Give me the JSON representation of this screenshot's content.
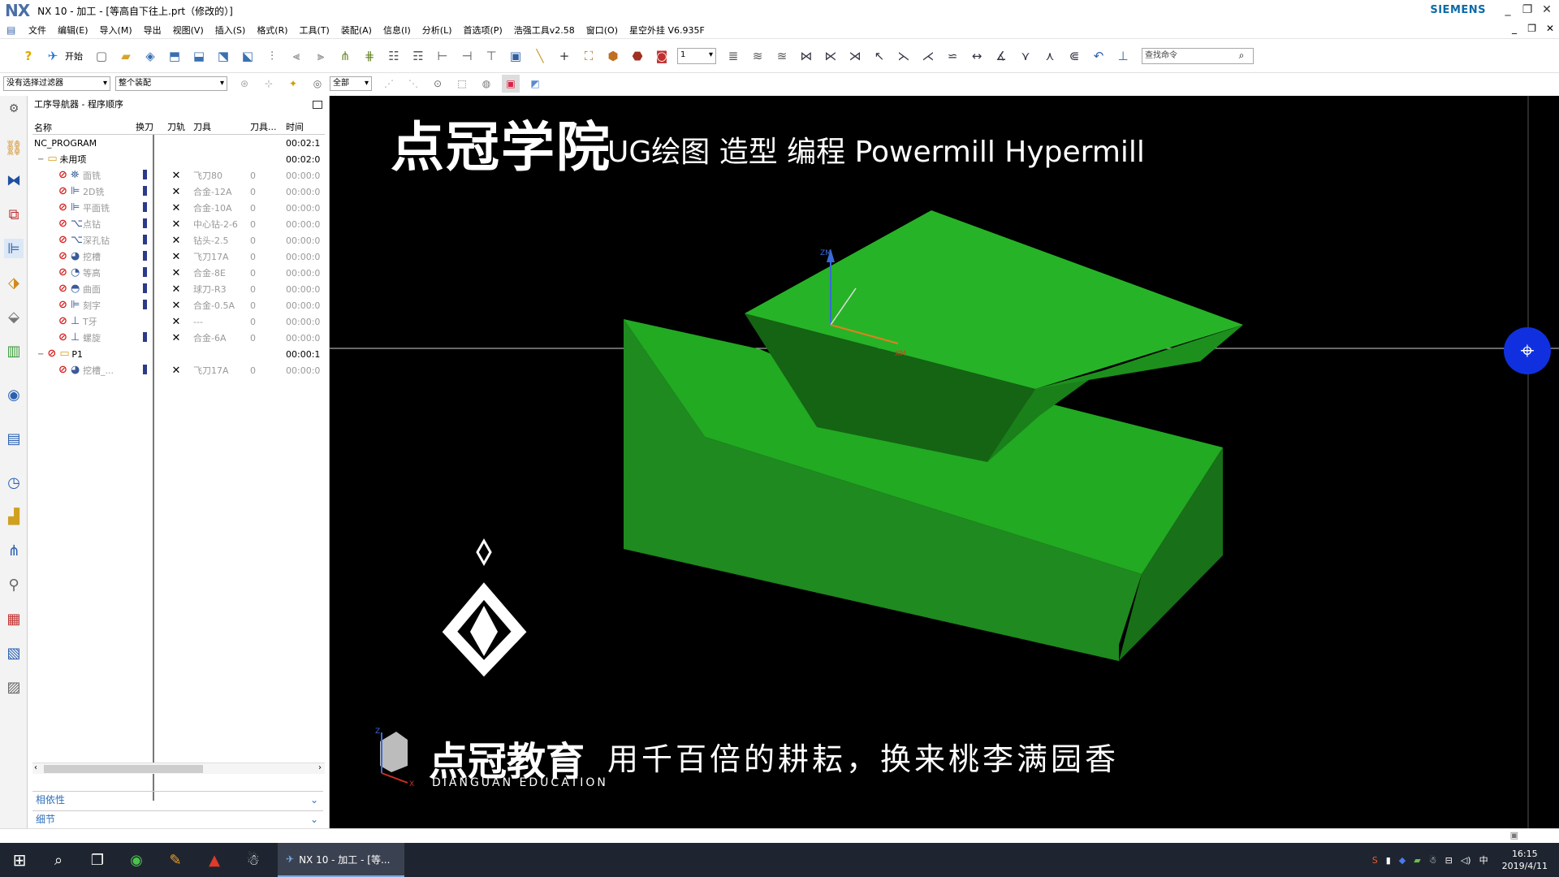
{
  "window": {
    "logo": "NX",
    "title": "NX 10 - 加工 - [等高自下往上.prt（修改的）]",
    "brand": "SIEMENS"
  },
  "menu": [
    "文件",
    "编辑(E)",
    "导入(M)",
    "导出",
    "视图(V)",
    "插入(S)",
    "格式(R)",
    "工具(T)",
    "装配(A)",
    "信息(I)",
    "分析(L)",
    "首选项(P)",
    "浩强工具v2.58",
    "窗口(O)",
    "星空外挂 V6.935F"
  ],
  "toolbar": {
    "start_label": "开始",
    "layer_value": "1",
    "search_placeholder": "查找命令"
  },
  "selection_bar": {
    "filter": "没有选择过滤器",
    "scope": "整个装配",
    "type": "全部"
  },
  "navigator": {
    "title": "工序导航器 - 程序顺序",
    "columns": [
      "名称",
      "换刀",
      "刀轨",
      "刀具",
      "刀具...",
      "时间"
    ],
    "rows": [
      {
        "name": "NC_PROGRAM",
        "time": "00:02:1",
        "level": 0
      },
      {
        "name": "未用项",
        "time": "00:02:0",
        "level": 1
      },
      {
        "name": "面铣",
        "tool": "飞刀80",
        "tn": "0",
        "time": "00:00:0",
        "level": 2,
        "icon": "face-mill-icon"
      },
      {
        "name": "2D铣",
        "tool": "合金-12A",
        "tn": "0",
        "time": "00:00:0",
        "level": 2,
        "icon": "planar-mill-icon"
      },
      {
        "name": "平面铣",
        "tool": "合金-10A",
        "tn": "0",
        "time": "00:00:0",
        "level": 2,
        "icon": "planar-mill-icon"
      },
      {
        "name": "点钻",
        "tool": "中心钻-2-6",
        "tn": "0",
        "time": "00:00:0",
        "level": 2,
        "icon": "drill-icon"
      },
      {
        "name": "深孔钻",
        "tool": "钻头-2.5",
        "tn": "0",
        "time": "00:00:0",
        "level": 2,
        "icon": "drill-icon"
      },
      {
        "name": "挖槽",
        "tool": "飞刀17A",
        "tn": "0",
        "time": "00:00:0",
        "level": 2,
        "icon": "cavity-mill-icon"
      },
      {
        "name": "等高",
        "tool": "合金-8E",
        "tn": "0",
        "time": "00:00:0",
        "level": 2,
        "icon": "zlevel-icon"
      },
      {
        "name": "曲面",
        "tool": "球刀-R3",
        "tn": "0",
        "time": "00:00:0",
        "level": 2,
        "icon": "contour-icon"
      },
      {
        "name": "刻字",
        "tool": "合金-0.5A",
        "tn": "0",
        "time": "00:00:0",
        "level": 2,
        "icon": "planar-mill-icon"
      },
      {
        "name": "T牙",
        "tool": "---",
        "tn": "0",
        "time": "00:00:0",
        "level": 2,
        "icon": "thread-mill-icon"
      },
      {
        "name": "螺旋",
        "tool": "合金-6A",
        "tn": "0",
        "time": "00:00:0",
        "level": 2,
        "icon": "thread-mill-icon"
      },
      {
        "name": "P1",
        "time": "00:00:1",
        "level": 1
      },
      {
        "name": "挖槽_...",
        "tool": "飞刀17A",
        "tn": "0",
        "time": "00:00:0",
        "level": 2,
        "icon": "cavity-mill-icon"
      }
    ],
    "panel_dependencies": "相依性",
    "panel_details": "细节"
  },
  "viewport": {
    "banner_brand": "点冠学院",
    "banner_subtitle": "UG绘图 造型 编程 Powermill Hypermill",
    "logo_text": "点冠教育",
    "logo_en": "DIANGUAN EDUCATION",
    "slogan": "用千百倍的耕耘，换来桃李满园香",
    "axis_z": "ZM",
    "axis_x": "XM"
  },
  "taskbar": {
    "nx_task": "NX 10 - 加工 - [等...",
    "ime": "中",
    "time": "16:15",
    "date": "2019/4/11"
  }
}
